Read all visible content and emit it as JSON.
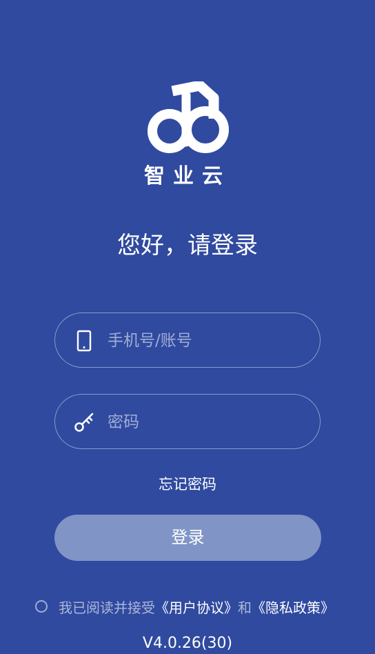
{
  "brand": {
    "logo_text": "智业云"
  },
  "greeting": "您好，请登录",
  "form": {
    "phone_placeholder": "手机号/账号",
    "phone_value": "",
    "password_placeholder": "密码",
    "password_value": ""
  },
  "forgot_password_label": "忘记密码",
  "login_button_label": "登录",
  "agreement": {
    "checked": false,
    "prefix": "我已阅读并接受",
    "user_agreement": "《用户协议》",
    "conjunction": "和",
    "privacy_policy": "《隐私政策》"
  },
  "version": "V4.0.26(30)",
  "colors": {
    "background": "#2f4a9f",
    "button": "#8095c6",
    "text": "#ffffff"
  }
}
